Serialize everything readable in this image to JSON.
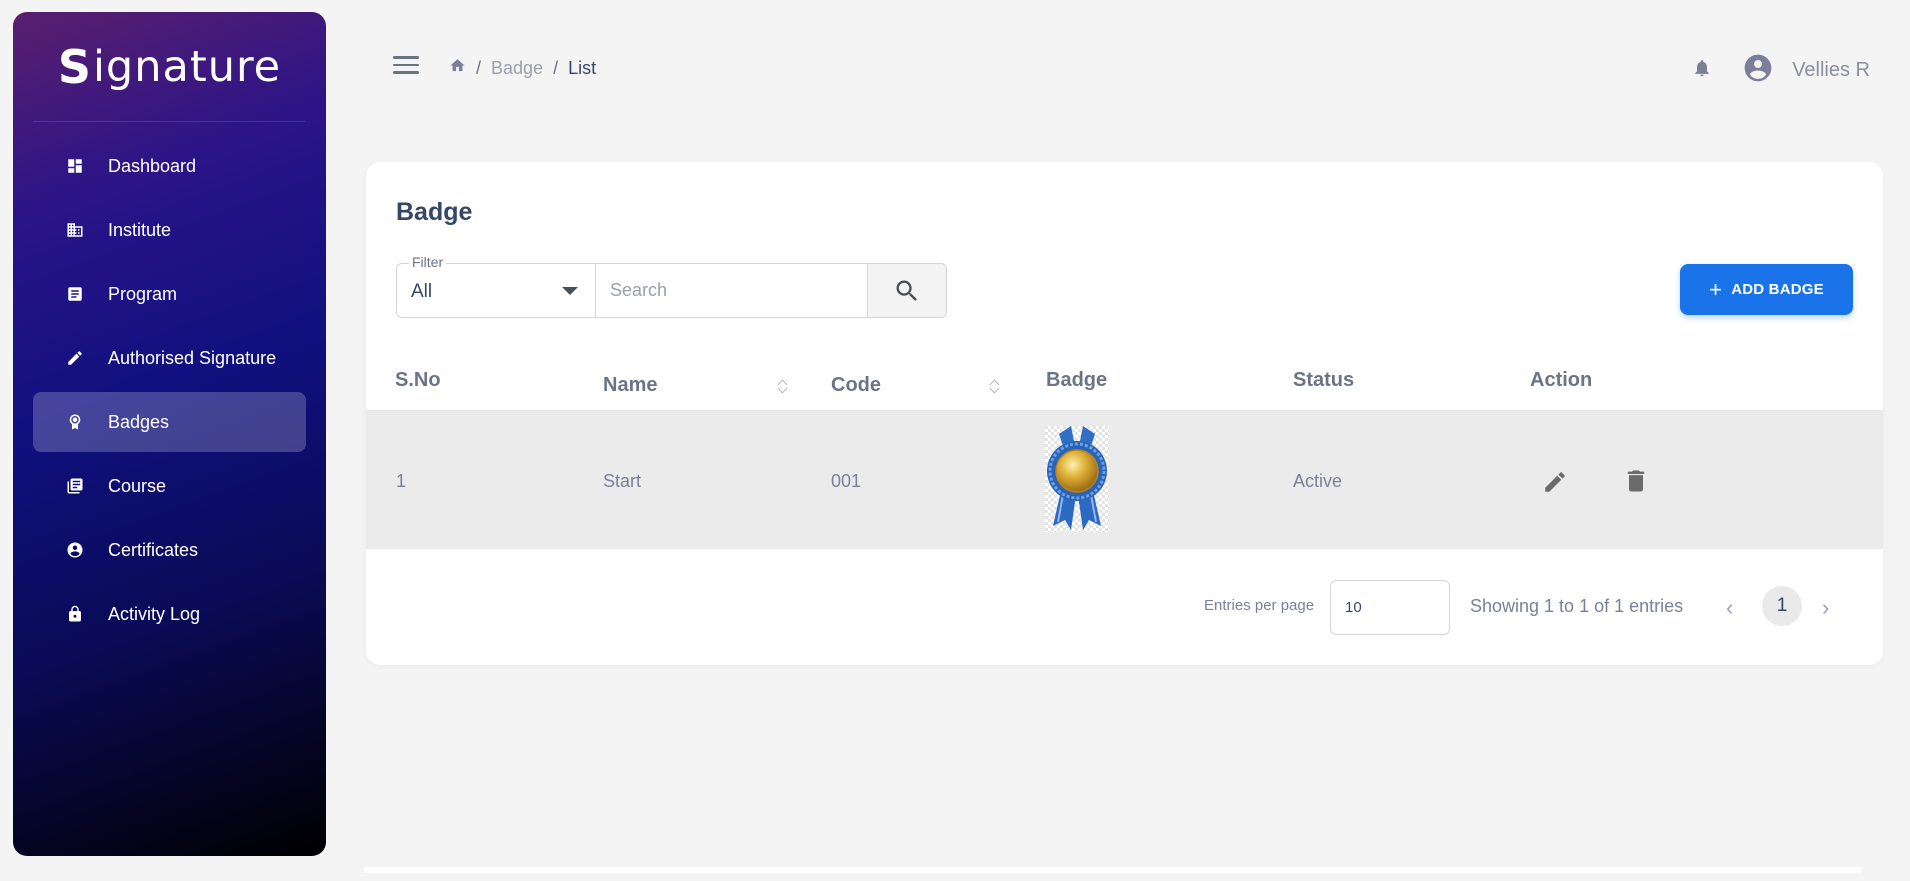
{
  "brand": {
    "name_lead": "S",
    "name_rest": "ignature"
  },
  "sidebar": {
    "items": [
      {
        "label": "Dashboard",
        "icon": "dashboard-icon"
      },
      {
        "label": "Institute",
        "icon": "institute-icon"
      },
      {
        "label": "Program",
        "icon": "program-icon"
      },
      {
        "label": "Authorised Signature",
        "icon": "pencil-icon"
      },
      {
        "label": "Badges",
        "icon": "badge-icon",
        "active": true
      },
      {
        "label": "Course",
        "icon": "course-icon"
      },
      {
        "label": "Certificates",
        "icon": "certificate-icon"
      },
      {
        "label": "Activity Log",
        "icon": "lock-icon"
      }
    ]
  },
  "header": {
    "breadcrumb": {
      "sep": "/",
      "section": "Badge",
      "current": "List"
    },
    "user_name": "Vellies R"
  },
  "card": {
    "title": "Badge",
    "filter": {
      "label": "Filter",
      "value": "All"
    },
    "search_placeholder": "Search",
    "add_button": {
      "plus": "+",
      "label": "ADD BADGE"
    }
  },
  "table": {
    "columns": [
      "S.No",
      "Name",
      "Code",
      "Badge",
      "Status",
      "Action"
    ],
    "rows": [
      {
        "sno": "1",
        "name": "Start",
        "code": "001",
        "status": "Active"
      }
    ]
  },
  "pagination": {
    "entries_label": "Entries per page",
    "entries_value": "10",
    "showing": "Showing 1 to 1 of 1 entries",
    "prev": "‹",
    "next": "›",
    "current_page": "1"
  },
  "colors": {
    "accent": "#1a73e8",
    "sidebar_gradient": [
      "#5a1f6e",
      "#10107f",
      "#000000"
    ]
  }
}
